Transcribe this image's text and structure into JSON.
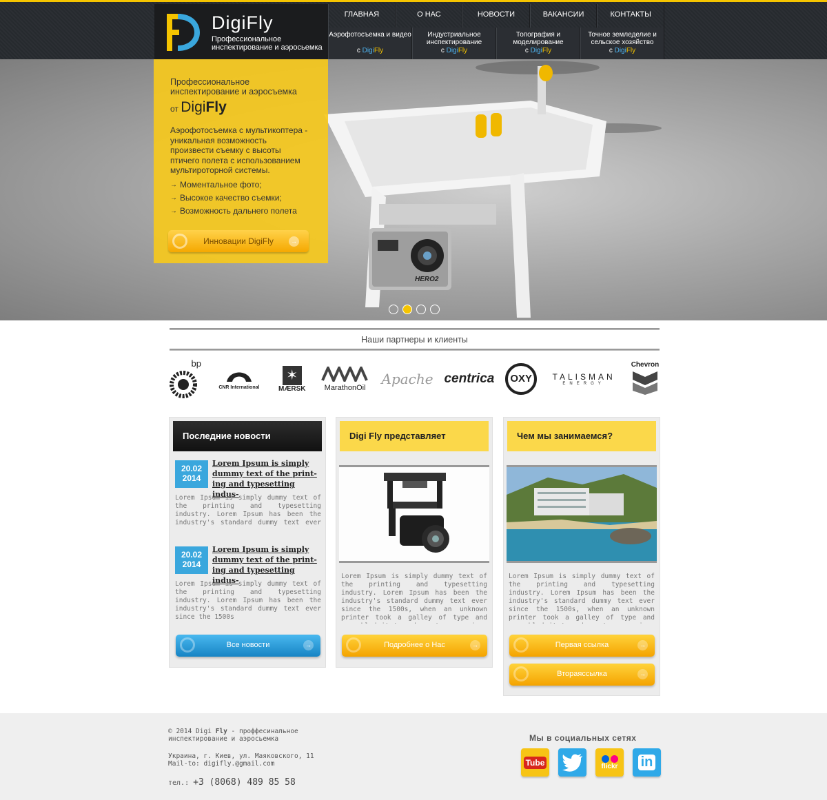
{
  "brand": {
    "name": "DigiFly",
    "tagline": "Профессиональное инспектирование и аэросьемка"
  },
  "nav_top": [
    "ГЛАВНАЯ",
    "О НАС",
    "НОВОСТИ",
    "ВАКАНСИИ",
    "КОНТАКТЫ"
  ],
  "nav_sub": [
    {
      "label": "Аэрофотосъемка и видео",
      "prefix": "с ",
      "digi": "Digi",
      "fly": "Fly"
    },
    {
      "label": "Индустриальное инспектирование",
      "prefix": "с ",
      "digi": "Digi",
      "fly": "Fly"
    },
    {
      "label": "Топография и моделирование",
      "prefix": "с ",
      "digi": "Digi",
      "fly": "Fly"
    },
    {
      "label": "Точное земледелие и сельское хозяйство",
      "prefix": "с ",
      "digi": "Digi",
      "fly": "Fly"
    }
  ],
  "hero": {
    "title": "Профессиональное инспектирование и аэросъемка",
    "by_prefix": "от ",
    "by_digi": "Digi",
    "by_fly": "Fly",
    "text": "Аэрофотосъемка с мультикоптера - уникальная возможность произвести съемку с высоты птичего полета с использованием мультироторной системы.",
    "list": [
      "Моментальное фото;",
      "Высокое качество съемки;",
      "Возможность дальнего полета"
    ],
    "button": "Инновации DigiFly",
    "camera_label": "HERO2",
    "slides": 4,
    "active_slide": 2
  },
  "partners": {
    "title": "Наши партнеры и клиенты",
    "logos": [
      "bp",
      "CNR International",
      "MÆRSK",
      "MarathonOil",
      "Apache",
      "centrica",
      "OXY",
      "TALISMAN",
      "ENERGY",
      "Chevron"
    ]
  },
  "news": {
    "heading": "Последние новости",
    "items": [
      {
        "day": "20.02",
        "year": "2014",
        "title": "Lorem Ipsum is simply dummy text of the print- ing and typesetting indus-",
        "body": "Lorem Ipsum is simply dummy text of the printing and typesetting industry. Lorem Ipsum has been the industry's standard dummy text ever since the"
      },
      {
        "day": "20.02",
        "year": "2014",
        "title": "Lorem Ipsum is simply dummy text of the print- ing and typesetting indus-",
        "body": "Lorem Ipsum is simply dummy text of the printing and typesetting industry. Lorem Ipsum has been the industry's standard dummy text ever since the 1500s"
      }
    ],
    "button": "Все новости"
  },
  "present": {
    "heading": "Digi Fly представляет",
    "body": "Lorem Ipsum is simply dummy text of the printing and typesetting industry. Lorem Ipsum has been the industry's standard dummy text ever since the 1500s, when an unknown printer took a galley of type and scrambled it to make a type specimen book. It has survived not",
    "button": "Подробнее о Нас"
  },
  "what": {
    "heading": "Чем мы занимаемся?",
    "body": "Lorem Ipsum is simply dummy text of the printing and typesetting industry. Lorem Ipsum has been the industry's standard dummy text ever since the 1500s, when an unknown printer took a galley of type and scrambled it to make a type specimen book. It has survived not",
    "button1": "Первая ссылка",
    "button2": "Втораяссылка"
  },
  "footer": {
    "copy_prefix": "© 2014 Digi ",
    "copy_fly": "Fly",
    "copy_rest": " - проффесинальное",
    "copy_line2": "инспектирование и аэросьемка",
    "address": "Украина, г. Киев, ул. Маяковского, 11",
    "mail": "Mail-to: digifly.@gmail.com",
    "phone_label": "тел.: ",
    "phone": "+3 (8068) 489 85 58",
    "social_title": "Мы в социальных сетях",
    "social": [
      {
        "name": "youtube",
        "label": "Tube",
        "color": "#f7c415"
      },
      {
        "name": "twitter",
        "label": "",
        "color": "#2fa9e8"
      },
      {
        "name": "flickr",
        "label": "flickr",
        "color": "#f7c415"
      },
      {
        "name": "linkedin",
        "label": "in",
        "color": "#2fa9e8"
      }
    ]
  },
  "colors": {
    "accent": "#f5c400",
    "blue": "#3aa7dd",
    "dark": "#1b1c1e"
  }
}
